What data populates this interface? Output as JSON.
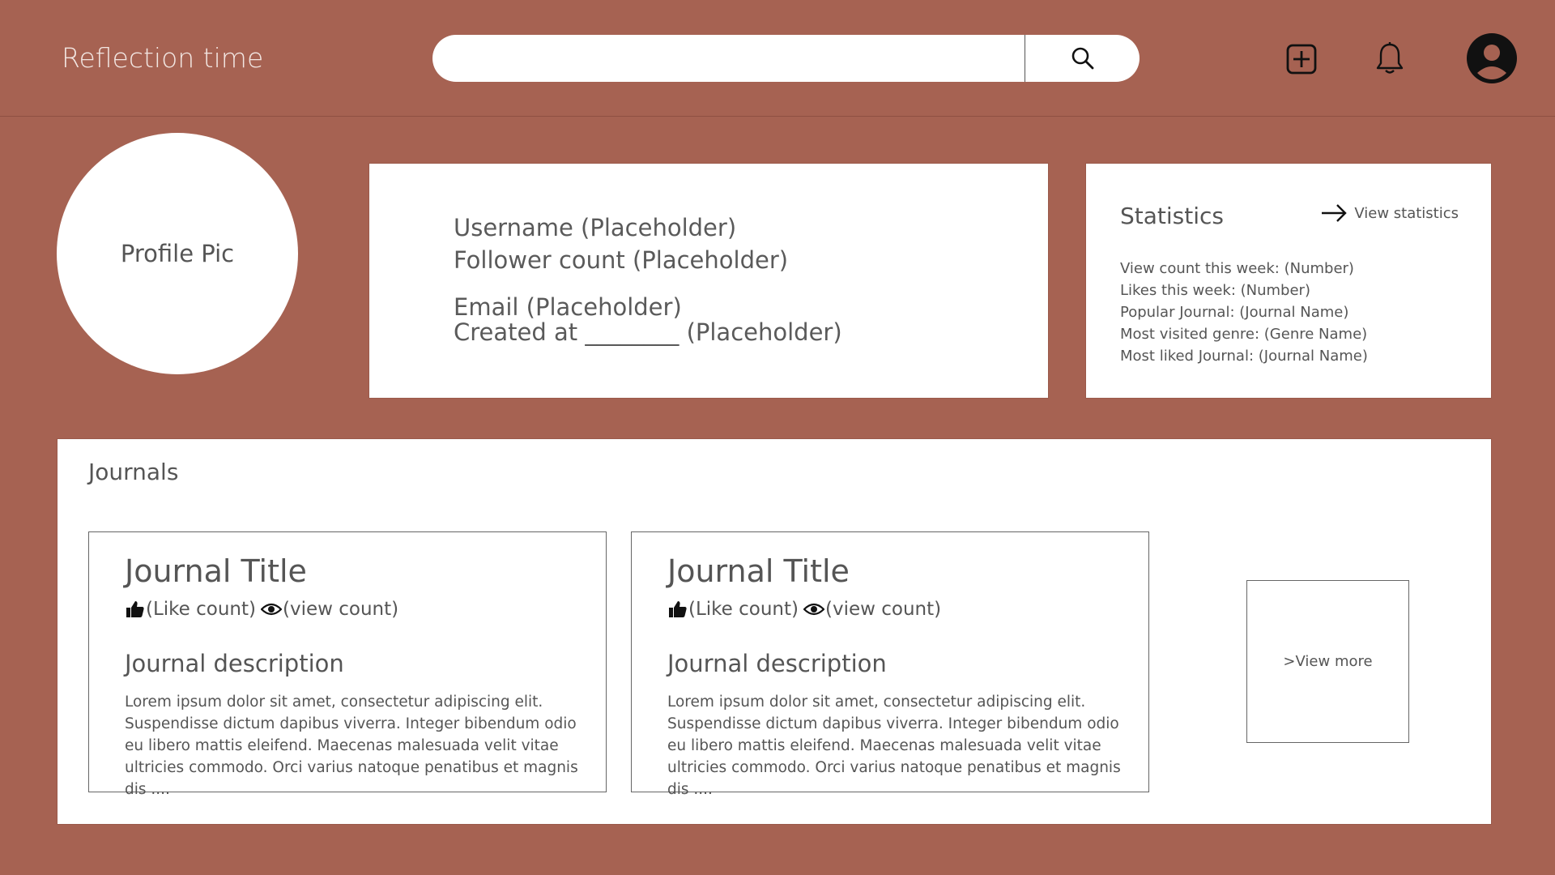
{
  "header": {
    "app_title": "Reflection time",
    "search": {
      "value": "",
      "placeholder": ""
    },
    "icons": [
      "search-icon",
      "add-square-icon",
      "bell-icon",
      "user-avatar-icon"
    ]
  },
  "profile": {
    "pic_label": "Profile Pic",
    "username": "Username (Placeholder)",
    "follower_count": "Follower count (Placeholder)",
    "email": "Email (Placeholder)",
    "created_at": "Created at ________ (Placeholder)"
  },
  "statistics": {
    "title": "Statistics",
    "view_link": "View statistics",
    "items": [
      "View count this week: (Number)",
      "Likes this week: (Number)",
      "Popular Journal: (Journal Name)",
      "Most visited genre: (Genre Name)",
      "Most liked Journal: (Journal Name)"
    ]
  },
  "journals": {
    "title": "Journals",
    "items": [
      {
        "title": "Journal Title",
        "likes": "(Like count)",
        "views": "(view count)",
        "desc_heading": "Journal description",
        "desc": "Lorem ipsum dolor sit amet, consectetur adipiscing elit. Suspendisse dictum dapibus viverra. Integer bibendum odio eu libero mattis eleifend. Maecenas malesuada velit vitae ultricies commodo. Orci varius natoque penatibus et magnis dis ...."
      },
      {
        "title": "Journal Title",
        "likes": "(Like count)",
        "views": "(view count)",
        "desc_heading": "Journal description",
        "desc": "Lorem ipsum dolor sit amet, consectetur adipiscing elit. Suspendisse dictum dapibus viverra. Integer bibendum odio eu libero mattis eleifend. Maecenas malesuada velit vitae ultricies commodo. Orci varius natoque penatibus et magnis dis ...."
      }
    ],
    "view_more": ">View more"
  },
  "colors": {
    "background": "#a66252",
    "card": "#ffffff",
    "text": "#5a5a5a"
  }
}
